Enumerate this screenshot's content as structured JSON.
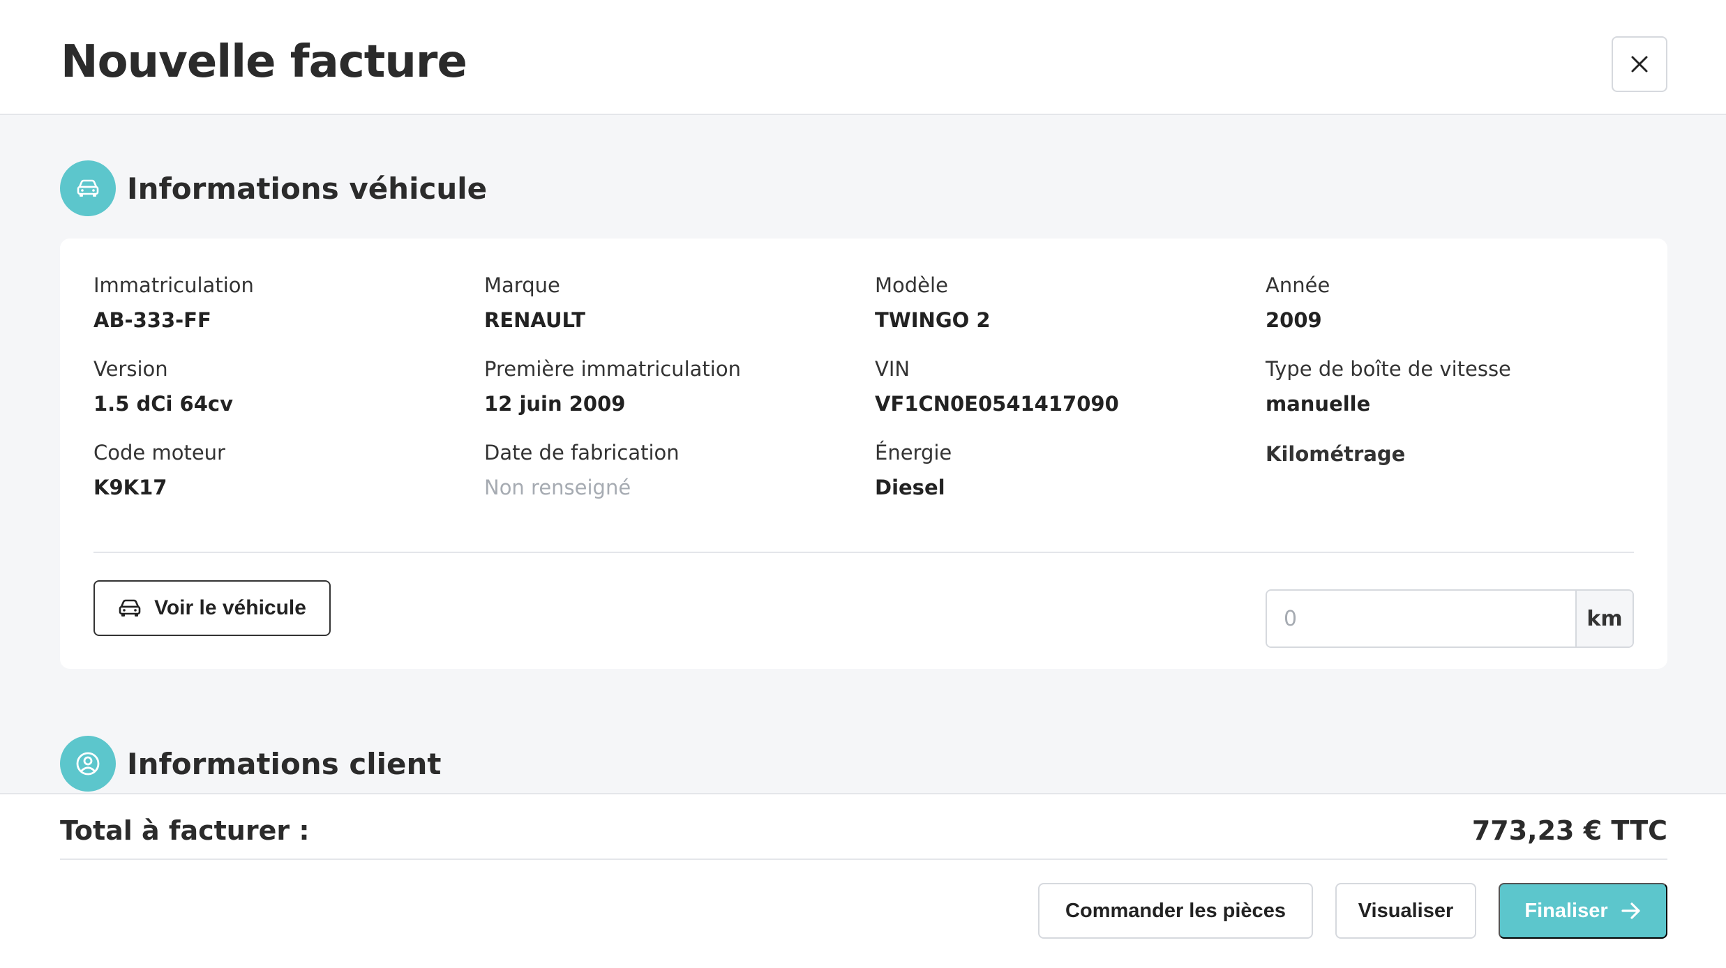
{
  "header": {
    "title": "Nouvelle facture",
    "close_icon": "close-icon"
  },
  "vehicle_section": {
    "title": "Informations véhicule",
    "icon": "car-icon",
    "fields": [
      {
        "label": "Immatriculation",
        "value": "AB-333-FF"
      },
      {
        "label": "Marque",
        "value": "RENAULT"
      },
      {
        "label": "Modèle",
        "value": "TWINGO 2"
      },
      {
        "label": "Année",
        "value": "2009"
      },
      {
        "label": "Version",
        "value": "1.5 dCi 64cv"
      },
      {
        "label": "Première immatriculation",
        "value": "12 juin 2009"
      },
      {
        "label": "VIN",
        "value": "VF1CN0E0541417090"
      },
      {
        "label": "Type de boîte de vitesse",
        "value": "manuelle"
      },
      {
        "label": "Code moteur",
        "value": "K9K17"
      },
      {
        "label": "Date de fabrication",
        "value": "Non renseigné"
      },
      {
        "label": "Énergie",
        "value": "Diesel"
      }
    ],
    "mileage": {
      "label": "Kilométrage",
      "value": "",
      "placeholder": "0",
      "unit": "km"
    },
    "view_vehicle_button": "Voir le véhicule"
  },
  "client_section": {
    "title": "Informations client",
    "icon": "user-circle-icon"
  },
  "footer": {
    "total_label": "Total à facturer :",
    "total_value": "773,23 € TTC",
    "order_parts_button": "Commander les pièces",
    "preview_button": "Visualiser",
    "finalize_button": "Finaliser",
    "finalize_icon": "arrow-right-icon"
  },
  "colors": {
    "accent": "#5cc6cc",
    "background": "#f5f6f8",
    "muted_text": "#a6abb2"
  }
}
